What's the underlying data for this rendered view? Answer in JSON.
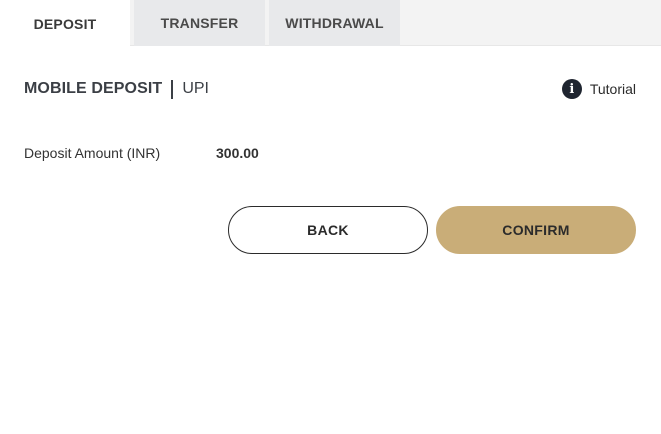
{
  "tabs": [
    {
      "label": "DEPOSIT",
      "active": true
    },
    {
      "label": "TRANSFER",
      "active": false
    },
    {
      "label": "WITHDRAWAL",
      "active": false
    }
  ],
  "header": {
    "title": "MOBILE DEPOSIT",
    "subtitle": "UPI",
    "tutorial_label": "Tutorial",
    "tutorial_icon": "info-icon",
    "tutorial_icon_glyph": "i"
  },
  "form": {
    "amount_label": "Deposit Amount (INR)",
    "amount_value": "300.00"
  },
  "actions": {
    "back_label": "BACK",
    "confirm_label": "CONFIRM"
  },
  "colors": {
    "accent": "#c9ad78",
    "icon_bg": "#1f2530",
    "tab_inactive_bg": "#e8e9eb"
  }
}
